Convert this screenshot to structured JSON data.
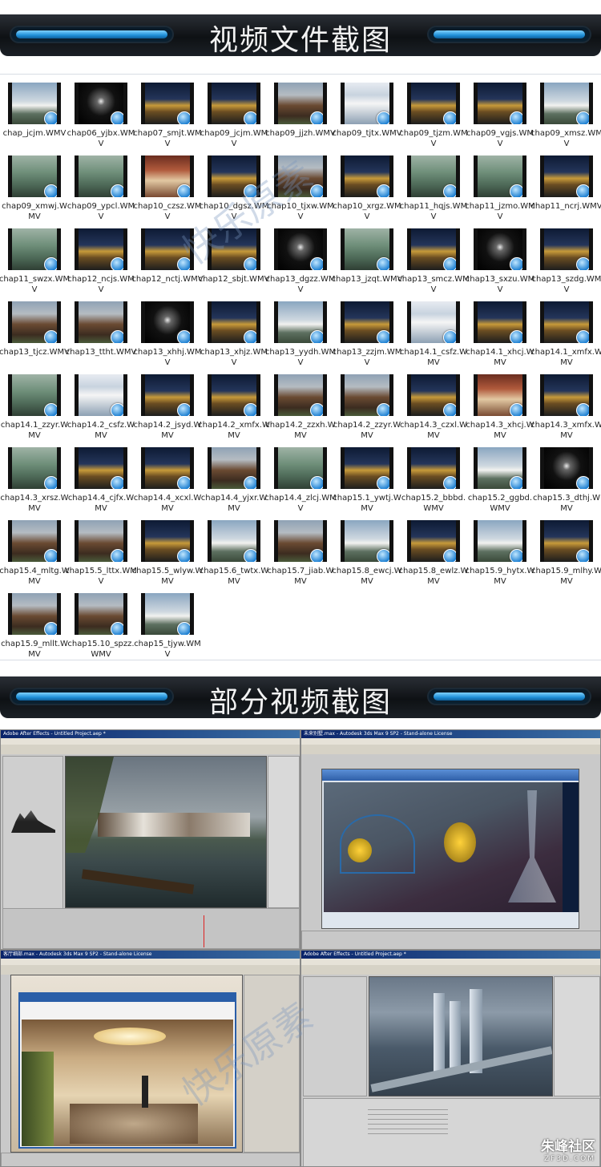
{
  "section1": {
    "title": "视频文件截图"
  },
  "section2": {
    "title": "部分视频截图"
  },
  "files": [
    "chap_jcjm.WMV",
    "chap06_yjbx.WMV",
    "chap07_smjt.WMV",
    "chap09_jcjm.WMV",
    "chap09_jjzh.WMV",
    "chap09_tjtx.WMV",
    "chap09_tjzm.WMV",
    "chap09_vgjs.WMV",
    "chap09_xmsz.WMV",
    "chap09_xmwj.WMV",
    "chap09_ypcl.WMV",
    "chap10_czsz.WMV",
    "chap10_dgsz.WMV",
    "chap10_tjxw.WMV",
    "chap10_xrgz.WMV",
    "chap11_hqjs.WMV",
    "chap11_jzmo.WMV",
    "chap11_ncrj.WMV",
    "chap11_swzx.WMV",
    "chap12_ncjs.WMV",
    "chap12_nctj.WMV",
    "chap12_sbjt.WMV",
    "chap13_dgzz.WMV",
    "chap13_jzqt.WMV",
    "chap13_smcz.WMV",
    "chap13_sxzu.WMV",
    "chap13_szdg.WMV",
    "chap13_tjcz.WMV",
    "chap13_ttht.WMV",
    "chap13_xhhj.WMV",
    "chap13_xhjz.WMV",
    "chap13_yydh.WMV",
    "chap13_zzjm.WMV",
    "chap14.1_csfz.WMV",
    "chap14.1_xhcj.WMV",
    "chap14.1_xmfx.WMV",
    "chap14.1_zzyr.WMV",
    "chap14.2_csfz.WMV",
    "chap14.2_jsyd.WMV",
    "chap14.2_xmfx.WMV",
    "chap14.2_zzxh.WMV",
    "chap14.2_zzyr.WMV",
    "chap14.3_czxl.WMV",
    "chap14.3_xhcj.WMV",
    "chap14.3_xmfx.WMV",
    "chap14.3_xrsz.WMV",
    "chap14.4_cjfx.WMV",
    "chap14.4_xcxl.WMV",
    "chap14.4_yjxr.WMV",
    "chap14.4_zlcj.WMV",
    "chap15.1_ywtj.WMV",
    "chap15.2_bbbd.WMV",
    "chap15.2_ggbd.WMV",
    "chap15.3_dthj.WMV",
    "chap15.4_mltg.WMV",
    "chap15.5_lttx.WMV",
    "chap15.5_wlyw.WMV",
    "chap15.6_twtx.WMV",
    "chap15.7_jiab.WMV",
    "chap15.8_ewcj.WMV",
    "chap15.8_ewlz.WMV",
    "chap15.9_hytx.WMV",
    "chap15.9_mlhy.WMV",
    "chap15.9_mllt.WMV",
    "chap15.10_spzz.WMV",
    "chap15_tjyw.WMV"
  ],
  "thumb_styles": [
    "villa-day",
    "dark-logo",
    "night-building",
    "night-building",
    "brick-house",
    "screen",
    "night-building",
    "night-building",
    "villa-day",
    "green-block",
    "green-block",
    "interior",
    "night-building",
    "brick-house",
    "night-building",
    "green-block",
    "green-block",
    "night-building",
    "green-block",
    "night-building",
    "night-building",
    "night-building",
    "dark-logo",
    "green-block",
    "night-building",
    "dark-logo",
    "night-building",
    "brick-house",
    "brick-house",
    "dark-logo",
    "night-building",
    "villa-day",
    "night-building",
    "screen",
    "night-building",
    "night-building",
    "green-block",
    "screen",
    "night-building",
    "night-building",
    "brick-house",
    "brick-house",
    "night-building",
    "interior",
    "night-building",
    "green-block",
    "night-building",
    "night-building",
    "brick-house",
    "green-block",
    "night-building",
    "night-building",
    "villa-day",
    "dark-logo",
    "brick-house",
    "brick-house",
    "night-building",
    "villa-day",
    "brick-house",
    "villa-day",
    "night-building",
    "villa-day",
    "night-building",
    "brick-house",
    "brick-house",
    "villa-day"
  ],
  "watermark": "快乐原素",
  "screenshots": [
    {
      "title": "Adobe After Effects - Untitled Project.aep *"
    },
    {
      "title": "未来别墅.max - Autodesk 3ds Max 9 SP2 - Stand-alone License"
    },
    {
      "title": "客厅细部.max - Autodesk 3ds Max 9 SP2 - Stand-alone License"
    },
    {
      "title": "Adobe After Effects - Untitled Project.aep *"
    }
  ],
  "site_logo": {
    "text": "朱峰社区",
    "url": "ZF3D.COM"
  },
  "colors": {
    "banner_bg": "#14181d",
    "pill_blue": "#1f8fd8",
    "titlebar": "#0a246a"
  }
}
